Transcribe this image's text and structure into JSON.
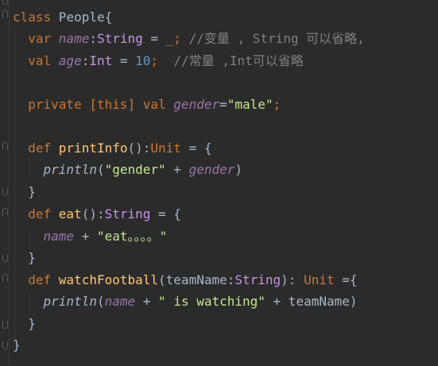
{
  "editor": {
    "lines": [
      {
        "id": "l1",
        "tokens": [
          {
            "t": "class",
            "c": "kw"
          },
          {
            "t": " People{",
            "c": "pl"
          }
        ]
      },
      {
        "id": "l2",
        "tokens": [
          {
            "t": "  var ",
            "c": "kw"
          },
          {
            "t": "name",
            "c": "prop"
          },
          {
            "t": ":",
            "c": "pl"
          },
          {
            "t": "String",
            "c": "type"
          },
          {
            "t": " = ",
            "c": "pl"
          },
          {
            "t": "_;",
            "c": "kw"
          },
          {
            "t": " //变量 , String 可以省略,",
            "c": "cmt"
          }
        ]
      },
      {
        "id": "l3",
        "tokens": [
          {
            "t": "  val ",
            "c": "kw"
          },
          {
            "t": "age",
            "c": "prop"
          },
          {
            "t": ":",
            "c": "pl"
          },
          {
            "t": "Int",
            "c": "type"
          },
          {
            "t": " = ",
            "c": "pl"
          },
          {
            "t": "10",
            "c": "num"
          },
          {
            "t": ";",
            "c": "kw"
          },
          {
            "t": "  //常量 ,Int可以省略",
            "c": "cmt"
          }
        ]
      },
      {
        "id": "l4",
        "tokens": []
      },
      {
        "id": "l5",
        "tokens": [
          {
            "t": "  private [",
            "c": "kw"
          },
          {
            "t": "this",
            "c": "kw"
          },
          {
            "t": "] val ",
            "c": "kw"
          },
          {
            "t": "gender",
            "c": "prop"
          },
          {
            "t": "=",
            "c": "pl"
          },
          {
            "t": "\"male\"",
            "c": "str2"
          },
          {
            "t": ";",
            "c": "kw"
          }
        ]
      },
      {
        "id": "l6",
        "tokens": []
      },
      {
        "id": "l7",
        "tokens": [
          {
            "t": "  def ",
            "c": "kw"
          },
          {
            "t": "printInfo",
            "c": "fn"
          },
          {
            "t": "():",
            "c": "pl"
          },
          {
            "t": "Unit",
            "c": "ty2"
          },
          {
            "t": " = {",
            "c": "pl"
          }
        ]
      },
      {
        "id": "l8",
        "tokens": [
          {
            "t": "    ",
            "c": "pl"
          },
          {
            "t": "println",
            "c": "fncall"
          },
          {
            "t": "(",
            "c": "pl"
          },
          {
            "t": "\"gender\"",
            "c": "str2"
          },
          {
            "t": " + ",
            "c": "pl"
          },
          {
            "t": "gender",
            "c": "prop"
          },
          {
            "t": ")",
            "c": "pl"
          }
        ]
      },
      {
        "id": "l9",
        "tokens": [
          {
            "t": "  }",
            "c": "pl"
          }
        ]
      },
      {
        "id": "l10",
        "tokens": [
          {
            "t": "  def ",
            "c": "kw"
          },
          {
            "t": "eat",
            "c": "fn"
          },
          {
            "t": "():",
            "c": "pl"
          },
          {
            "t": "String",
            "c": "type"
          },
          {
            "t": " = {",
            "c": "pl"
          }
        ]
      },
      {
        "id": "l11",
        "tokens": [
          {
            "t": "    ",
            "c": "pl"
          },
          {
            "t": "name",
            "c": "prop"
          },
          {
            "t": " + ",
            "c": "pl"
          },
          {
            "t": "\"eat。。。。\"",
            "c": "str2"
          }
        ]
      },
      {
        "id": "l12",
        "tokens": [
          {
            "t": "  }",
            "c": "pl"
          }
        ]
      },
      {
        "id": "l13",
        "tokens": [
          {
            "t": "  def ",
            "c": "kw"
          },
          {
            "t": "watchFootball",
            "c": "fn"
          },
          {
            "t": "(teamName:",
            "c": "pl"
          },
          {
            "t": "String",
            "c": "type"
          },
          {
            "t": "): ",
            "c": "pl"
          },
          {
            "t": "Unit",
            "c": "ty2"
          },
          {
            "t": " ={",
            "c": "pl"
          }
        ]
      },
      {
        "id": "l14",
        "tokens": [
          {
            "t": "    ",
            "c": "pl"
          },
          {
            "t": "println",
            "c": "fncall"
          },
          {
            "t": "(",
            "c": "pl"
          },
          {
            "t": "name",
            "c": "prop"
          },
          {
            "t": " + ",
            "c": "pl"
          },
          {
            "t": "\" is watching\"",
            "c": "str2"
          },
          {
            "t": " + teamName)",
            "c": "pl"
          }
        ]
      },
      {
        "id": "l15",
        "tokens": [
          {
            "t": "  }",
            "c": "pl"
          }
        ]
      },
      {
        "id": "l16",
        "tokens": [
          {
            "t": "}",
            "c": "pl"
          }
        ]
      }
    ]
  }
}
